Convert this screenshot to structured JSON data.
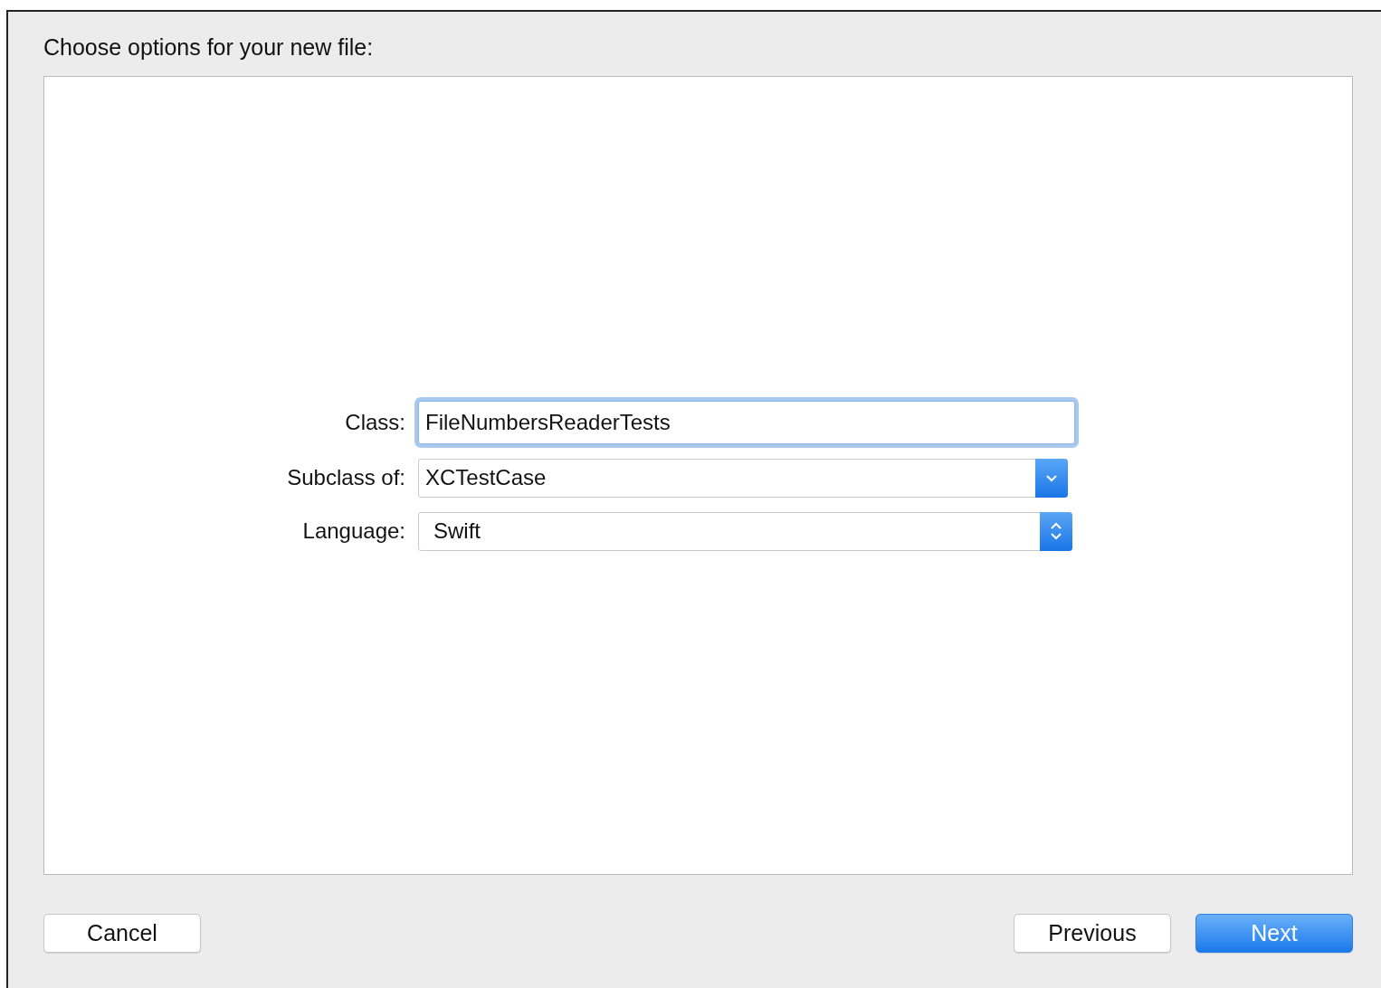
{
  "dialog": {
    "title": "Choose options for your new file:"
  },
  "fields": [
    {
      "label": "Class:",
      "kind": "text",
      "value": "FileNumbersReaderTests",
      "focused": true
    },
    {
      "label": "Subclass of:",
      "kind": "pulldown",
      "value": "XCTestCase",
      "focused": false
    },
    {
      "label": "Language:",
      "kind": "popup",
      "value": "Swift",
      "focused": false
    }
  ],
  "left_buttons": [
    {
      "label": "Cancel",
      "default": false
    }
  ],
  "right_buttons": [
    {
      "label": "Previous",
      "default": false
    },
    {
      "label": "Next",
      "default": true
    }
  ]
}
